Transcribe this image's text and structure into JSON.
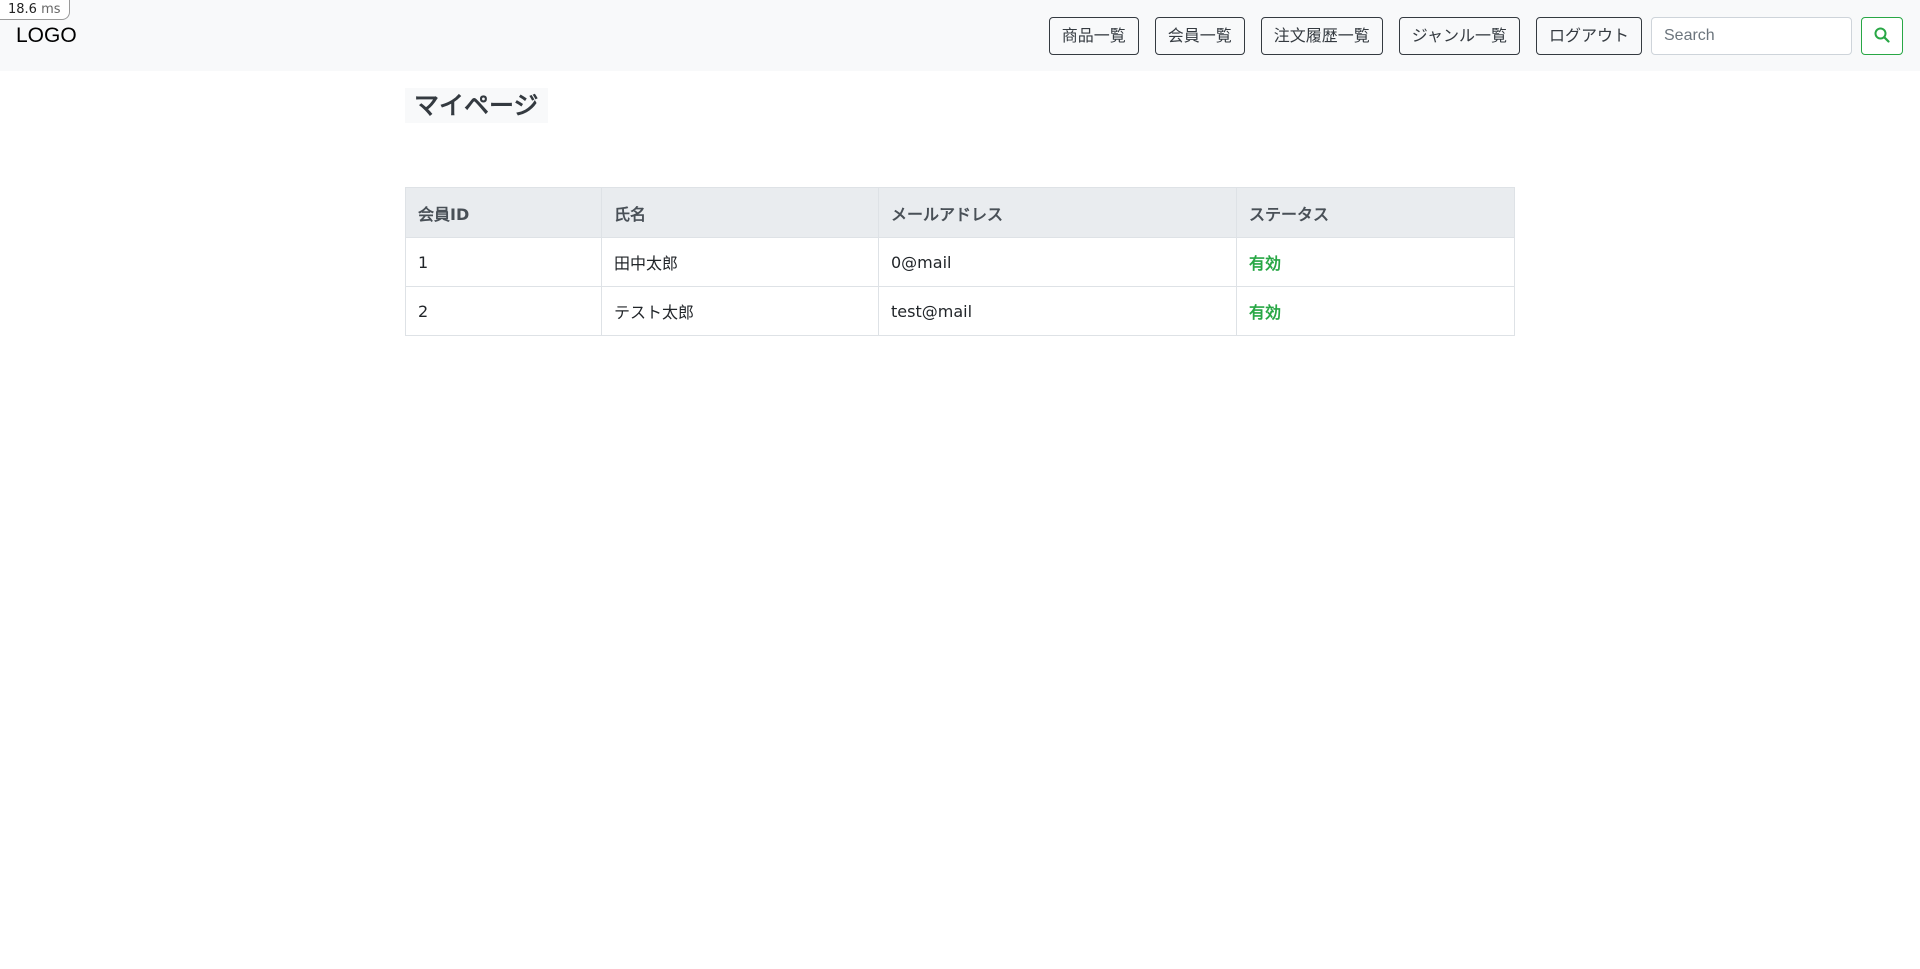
{
  "perf_badge": {
    "value": "18.6",
    "unit": "ms"
  },
  "navbar": {
    "brand": "LOGO",
    "buttons": [
      {
        "label": "商品一覧"
      },
      {
        "label": "会員一覧"
      },
      {
        "label": "注文履歴一覧"
      },
      {
        "label": "ジャンル一覧"
      },
      {
        "label": "ログアウト"
      }
    ],
    "search": {
      "placeholder": "Search",
      "value": "",
      "button_icon": "search-icon"
    }
  },
  "page": {
    "title": "マイページ"
  },
  "table": {
    "headers": [
      "会員ID",
      "氏名",
      "メールアドレス",
      "ステータス"
    ],
    "rows": [
      [
        "1",
        "田中太郎",
        "0@mail",
        "有効"
      ],
      [
        "2",
        "テスト太郎",
        "test@mail",
        "有効"
      ]
    ]
  },
  "colors": {
    "status_active": "#28a745",
    "navbar_bg": "#f8f9fa",
    "table_header_bg": "#e9ecef"
  }
}
